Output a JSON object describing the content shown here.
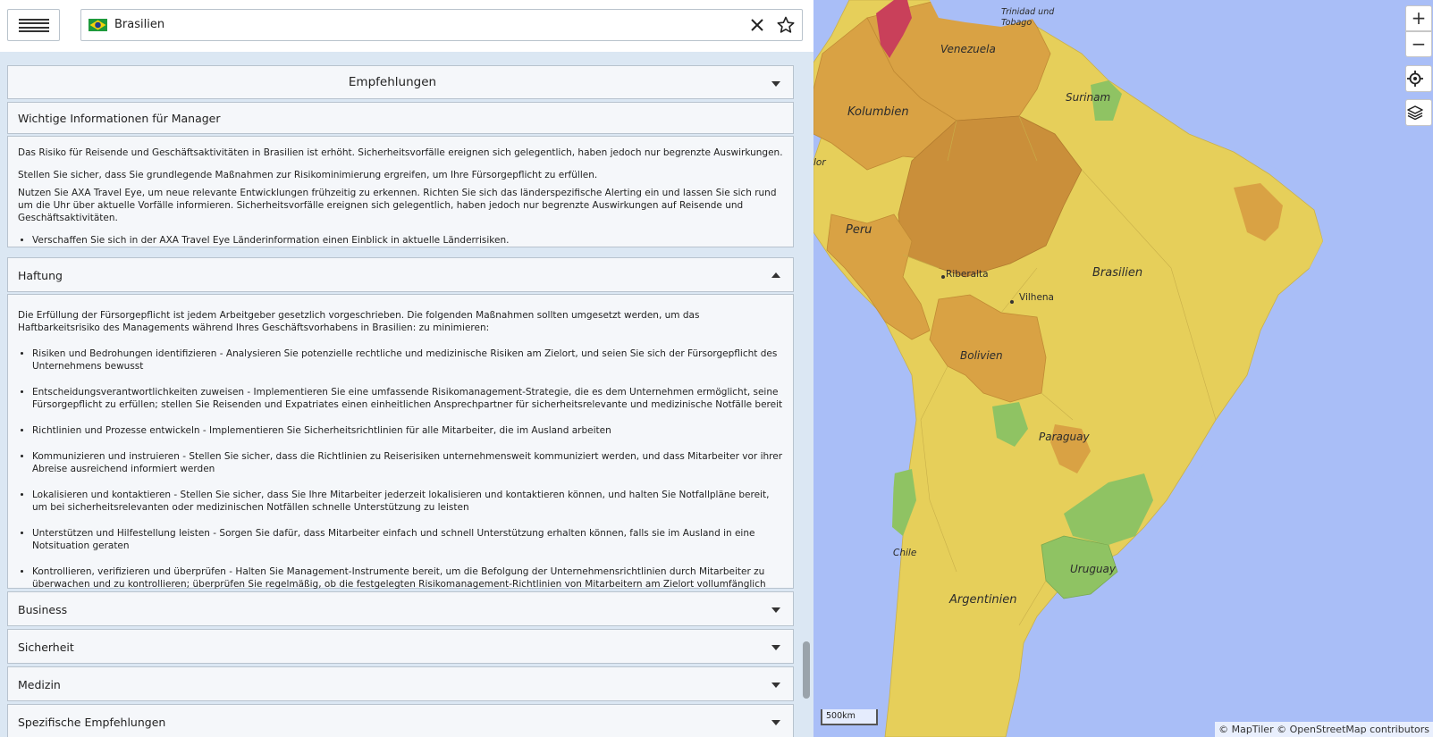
{
  "search": {
    "country": "Brasilien",
    "flag_icon": "brazil-flag-icon"
  },
  "panel": {
    "header_title": "Empfehlungen",
    "sections": {
      "managers": {
        "title": "Wichtige Informationen für Manager",
        "p1": "Das Risiko für Reisende und Geschäftsaktivitäten in Brasilien ist erhöht. Sicherheitsvorfälle ereignen sich gelegentlich, haben jedoch nur begrenzte Auswirkungen.",
        "p2": "Stellen Sie sicher, dass Sie grundlegende Maßnahmen zur Risikominimierung ergreifen, um Ihre Fürsorgepflicht zu erfüllen.",
        "p3": "Nutzen Sie AXA Travel Eye, um neue relevante Entwicklungen frühzeitig zu erkennen. Richten Sie sich das länderspezifische Alerting ein und lassen Sie sich rund um die Uhr über aktuelle Vorfälle informieren. Sicherheitsvorfälle ereignen sich gelegentlich, haben jedoch nur begrenzte Auswirkungen auf Reisende und Geschäftsaktivitäten.",
        "bullet1": "Verschaffen Sie sich in der AXA Travel Eye Länderinformation einen Einblick in aktuelle Länderrisiken."
      },
      "haftung": {
        "title": "Haftung",
        "intro": "Die Erfüllung der Fürsorgepflicht ist jedem Arbeitgeber gesetzlich vorgeschrieben. Die folgenden Maßnahmen sollten umgesetzt werden, um das Haftbarkeitsrisiko des Managements während Ihres Geschäftsvorhabens in Brasilien: zu minimieren:",
        "items": [
          "Risiken und Bedrohungen identifizieren - Analysieren Sie potenzielle rechtliche und medizinische Risiken am Zielort, und seien Sie sich der Fürsorgepflicht des Unternehmens bewusst",
          "Entscheidungsverantwortlichkeiten zuweisen - Implementieren Sie eine umfassende Risikomanagement-Strategie, die es dem Unternehmen ermöglicht, seine Fürsorgepflicht zu erfüllen; stellen Sie Reisenden und Expatriates einen einheitlichen Ansprechpartner für sicherheitsrelevante und medizinische Notfälle bereit",
          "Richtlinien und Prozesse entwickeln - Implementieren Sie Sicherheitsrichtlinien für alle Mitarbeiter, die im Ausland arbeiten",
          "Kommunizieren und instruieren - Stellen Sie sicher, dass die Richtlinien zu Reiserisiken unternehmensweit kommuniziert werden, und dass Mitarbeiter vor ihrer Abreise ausreichend informiert werden",
          "Lokalisieren und kontaktieren - Stellen Sie sicher, dass Sie Ihre Mitarbeiter jederzeit lokalisieren und kontaktieren können, und halten Sie Notfallpläne bereit, um bei sicherheitsrelevanten oder medizinischen Notfällen schnelle Unterstützung zu leisten",
          "Unterstützen und Hilfestellung leisten - Sorgen Sie dafür, dass Mitarbeiter einfach und schnell Unterstützung erhalten können, falls sie im Ausland in eine Notsituation geraten",
          "Kontrollieren, verifizieren und überprüfen - Halten Sie Management-Instrumente bereit, um die Befolgung der Unternehmensrichtlinien durch Mitarbeiter zu überwachen und zu kontrollieren; überprüfen Sie regelmäßig, ob die festgelegten Risikomanagement-Richtlinien von Mitarbeitern am Zielort vollumfänglich umgesetzt werden"
        ]
      },
      "business": {
        "title": "Business"
      },
      "security": {
        "title": "Sicherheit"
      },
      "medicine": {
        "title": "Medizin"
      },
      "specific": {
        "title": "Spezifische Empfehlungen"
      }
    }
  },
  "map": {
    "labels": {
      "trinidad": "Trinidad und Tobago",
      "venezuela": "Venezuela",
      "surinam": "Surinam",
      "kolumbien": "Kolumbien",
      "ecuador_partial": "lor",
      "peru": "Peru",
      "brasilien": "Brasilien",
      "riberalta": "Riberalta",
      "vilhena": "Vilhena",
      "bolivien": "Bolivien",
      "paraguay": "Paraguay",
      "chile": "Chile",
      "uruguay": "Uruguay",
      "argentinien": "Argentinien"
    },
    "zoom_in": "+",
    "zoom_out": "−",
    "scale": "500km",
    "attribution": "© MapTiler © OpenStreetMap contributors",
    "colors": {
      "ocean": "#a9bef7",
      "low_risk": "#8fc363",
      "medium_risk": "#e6cf5a",
      "elevated_risk": "#d9a244",
      "high_risk": "#ca8f3a",
      "very_high_risk": "#c9405a"
    }
  }
}
